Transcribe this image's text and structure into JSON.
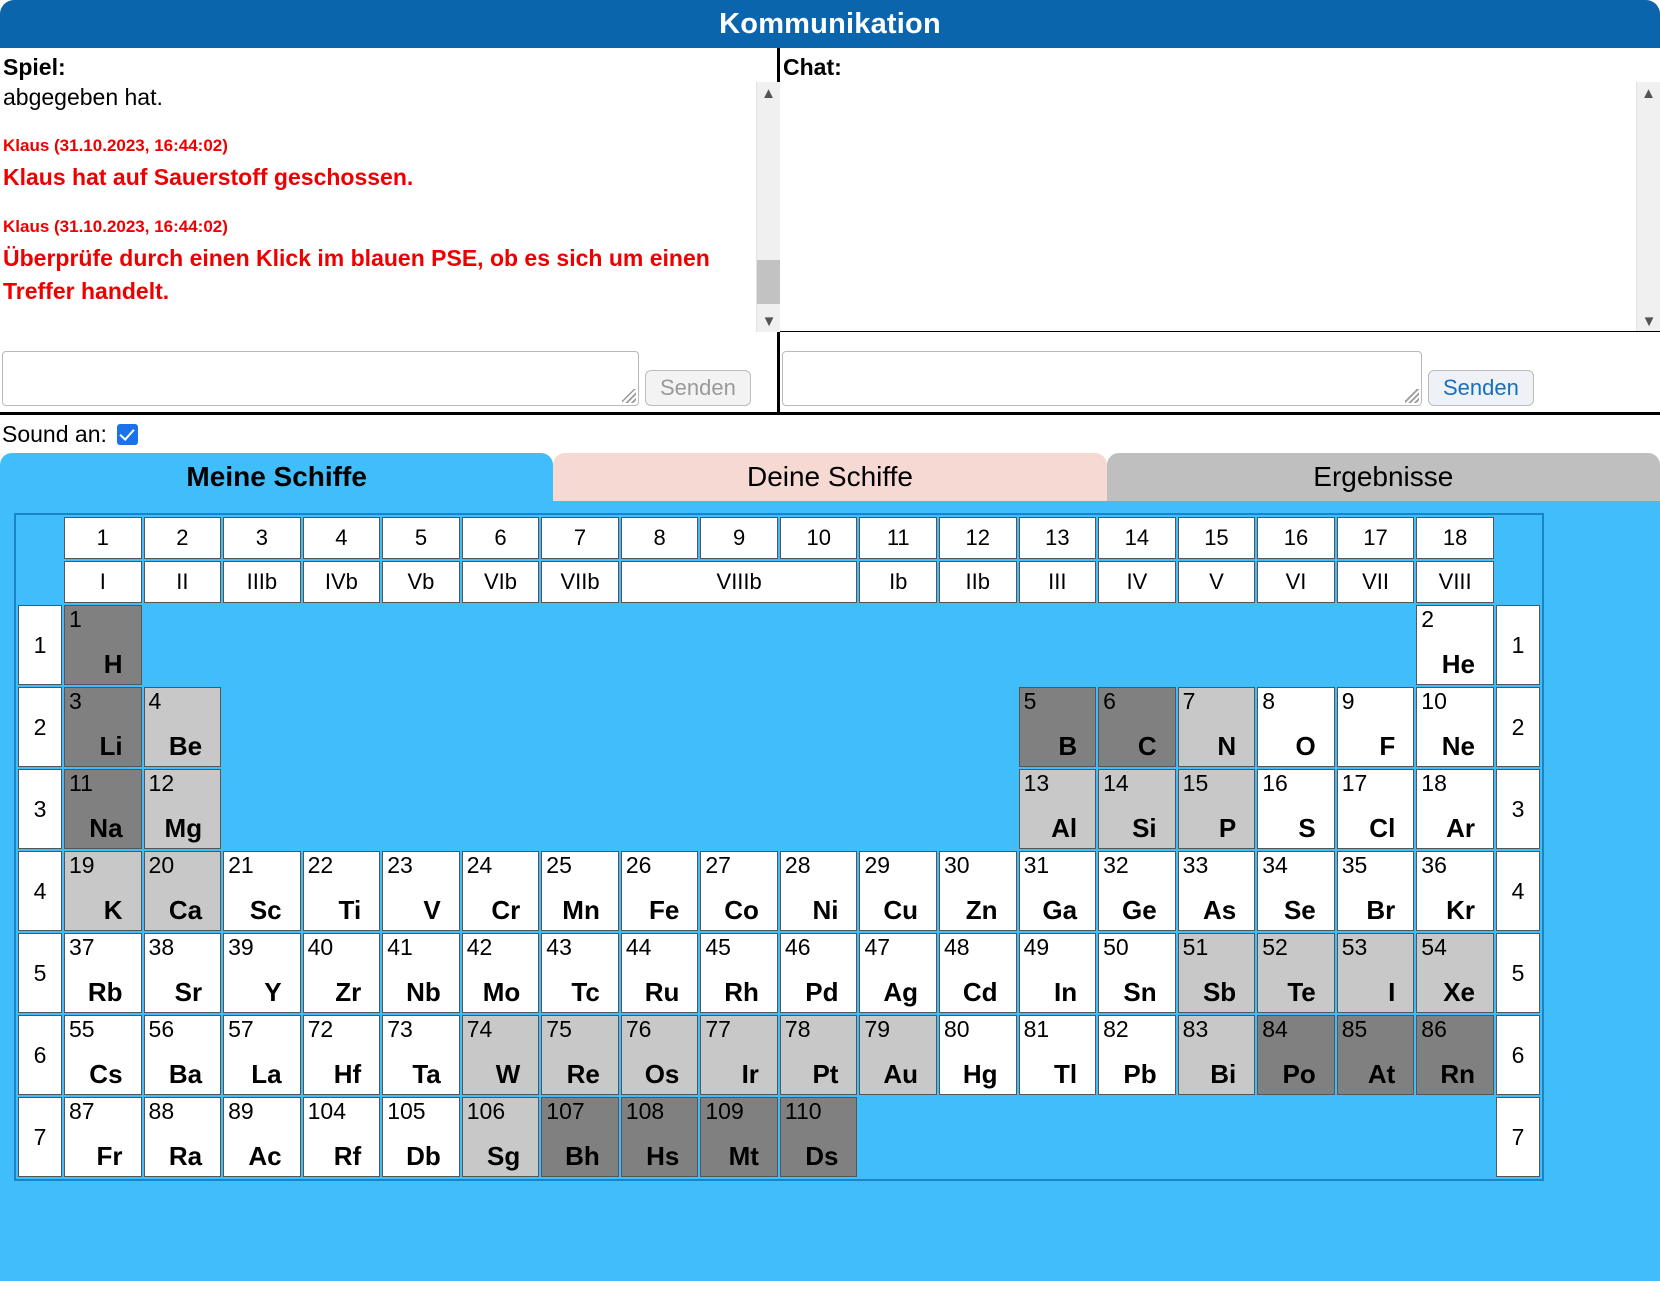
{
  "window": {
    "title": "Kommunikation"
  },
  "comm": {
    "game": {
      "label": "Spiel:",
      "entries": [
        {
          "type": "plain",
          "text": "abgegeben hat."
        },
        {
          "type": "meta",
          "text": "Klaus (31.10.2023, 16:44:02)"
        },
        {
          "type": "msg",
          "text": "Klaus hat auf Sauerstoff geschossen."
        },
        {
          "type": "meta",
          "text": "Klaus (31.10.2023, 16:44:02)"
        },
        {
          "type": "msg",
          "text": "Überprüfe durch einen Klick im blauen PSE, ob es sich um einen Treffer handelt."
        }
      ],
      "input_value": "",
      "send_label": "Senden"
    },
    "chat": {
      "label": "Chat:",
      "entries": [],
      "input_value": "",
      "send_label": "Senden"
    }
  },
  "sound": {
    "label": "Sound an:",
    "checked": true
  },
  "tabs": [
    {
      "id": "meine-schiffe",
      "label": "Meine Schiffe",
      "state": "active"
    },
    {
      "id": "deine-schiffe",
      "label": "Deine Schiffe",
      "state": "pink"
    },
    {
      "id": "ergebnisse",
      "label": "Ergebnisse",
      "state": "grey"
    }
  ],
  "pse": {
    "group_numbers": [
      "1",
      "2",
      "3",
      "4",
      "5",
      "6",
      "7",
      "8",
      "9",
      "10",
      "11",
      "12",
      "13",
      "14",
      "15",
      "16",
      "17",
      "18"
    ],
    "group_romans": [
      {
        "label": "I",
        "span": 1
      },
      {
        "label": "II",
        "span": 1
      },
      {
        "label": "IIIb",
        "span": 1
      },
      {
        "label": "IVb",
        "span": 1
      },
      {
        "label": "Vb",
        "span": 1
      },
      {
        "label": "VIb",
        "span": 1
      },
      {
        "label": "VIIb",
        "span": 1
      },
      {
        "label": "VIIIb",
        "span": 3
      },
      {
        "label": "Ib",
        "span": 1
      },
      {
        "label": "IIb",
        "span": 1
      },
      {
        "label": "III",
        "span": 1
      },
      {
        "label": "IV",
        "span": 1
      },
      {
        "label": "V",
        "span": 1
      },
      {
        "label": "VI",
        "span": 1
      },
      {
        "label": "VII",
        "span": 1
      },
      {
        "label": "VIII",
        "span": 1
      }
    ],
    "period_labels": [
      "1",
      "2",
      "3",
      "4",
      "5",
      "6",
      "7"
    ],
    "rows": [
      {
        "period": "1",
        "cells": [
          {
            "num": "1",
            "sym": "H",
            "shade": "dark"
          },
          {
            "blank": 16
          },
          {
            "num": "2",
            "sym": "He",
            "shade": "none"
          }
        ]
      },
      {
        "period": "2",
        "cells": [
          {
            "num": "3",
            "sym": "Li",
            "shade": "dark"
          },
          {
            "num": "4",
            "sym": "Be",
            "shade": "light"
          },
          {
            "blank": 10
          },
          {
            "num": "5",
            "sym": "B",
            "shade": "dark"
          },
          {
            "num": "6",
            "sym": "C",
            "shade": "dark"
          },
          {
            "num": "7",
            "sym": "N",
            "shade": "light"
          },
          {
            "num": "8",
            "sym": "O",
            "shade": "none"
          },
          {
            "num": "9",
            "sym": "F",
            "shade": "none"
          },
          {
            "num": "10",
            "sym": "Ne",
            "shade": "none"
          }
        ]
      },
      {
        "period": "3",
        "cells": [
          {
            "num": "11",
            "sym": "Na",
            "shade": "dark"
          },
          {
            "num": "12",
            "sym": "Mg",
            "shade": "light"
          },
          {
            "blank": 10
          },
          {
            "num": "13",
            "sym": "Al",
            "shade": "light"
          },
          {
            "num": "14",
            "sym": "Si",
            "shade": "light"
          },
          {
            "num": "15",
            "sym": "P",
            "shade": "light"
          },
          {
            "num": "16",
            "sym": "S",
            "shade": "none"
          },
          {
            "num": "17",
            "sym": "Cl",
            "shade": "none"
          },
          {
            "num": "18",
            "sym": "Ar",
            "shade": "none"
          }
        ]
      },
      {
        "period": "4",
        "cells": [
          {
            "num": "19",
            "sym": "K",
            "shade": "light"
          },
          {
            "num": "20",
            "sym": "Ca",
            "shade": "light"
          },
          {
            "num": "21",
            "sym": "Sc",
            "shade": "none"
          },
          {
            "num": "22",
            "sym": "Ti",
            "shade": "none"
          },
          {
            "num": "23",
            "sym": "V",
            "shade": "none"
          },
          {
            "num": "24",
            "sym": "Cr",
            "shade": "none"
          },
          {
            "num": "25",
            "sym": "Mn",
            "shade": "none"
          },
          {
            "num": "26",
            "sym": "Fe",
            "shade": "none"
          },
          {
            "num": "27",
            "sym": "Co",
            "shade": "none"
          },
          {
            "num": "28",
            "sym": "Ni",
            "shade": "none"
          },
          {
            "num": "29",
            "sym": "Cu",
            "shade": "none"
          },
          {
            "num": "30",
            "sym": "Zn",
            "shade": "none"
          },
          {
            "num": "31",
            "sym": "Ga",
            "shade": "none"
          },
          {
            "num": "32",
            "sym": "Ge",
            "shade": "none"
          },
          {
            "num": "33",
            "sym": "As",
            "shade": "none"
          },
          {
            "num": "34",
            "sym": "Se",
            "shade": "none"
          },
          {
            "num": "35",
            "sym": "Br",
            "shade": "none"
          },
          {
            "num": "36",
            "sym": "Kr",
            "shade": "none"
          }
        ]
      },
      {
        "period": "5",
        "cells": [
          {
            "num": "37",
            "sym": "Rb",
            "shade": "none"
          },
          {
            "num": "38",
            "sym": "Sr",
            "shade": "none"
          },
          {
            "num": "39",
            "sym": "Y",
            "shade": "none"
          },
          {
            "num": "40",
            "sym": "Zr",
            "shade": "none"
          },
          {
            "num": "41",
            "sym": "Nb",
            "shade": "none"
          },
          {
            "num": "42",
            "sym": "Mo",
            "shade": "none"
          },
          {
            "num": "43",
            "sym": "Tc",
            "shade": "none"
          },
          {
            "num": "44",
            "sym": "Ru",
            "shade": "none"
          },
          {
            "num": "45",
            "sym": "Rh",
            "shade": "none"
          },
          {
            "num": "46",
            "sym": "Pd",
            "shade": "none"
          },
          {
            "num": "47",
            "sym": "Ag",
            "shade": "none"
          },
          {
            "num": "48",
            "sym": "Cd",
            "shade": "none"
          },
          {
            "num": "49",
            "sym": "In",
            "shade": "none"
          },
          {
            "num": "50",
            "sym": "Sn",
            "shade": "none"
          },
          {
            "num": "51",
            "sym": "Sb",
            "shade": "light"
          },
          {
            "num": "52",
            "sym": "Te",
            "shade": "light"
          },
          {
            "num": "53",
            "sym": "I",
            "shade": "light"
          },
          {
            "num": "54",
            "sym": "Xe",
            "shade": "light"
          }
        ]
      },
      {
        "period": "6",
        "cells": [
          {
            "num": "55",
            "sym": "Cs",
            "shade": "none"
          },
          {
            "num": "56",
            "sym": "Ba",
            "shade": "none"
          },
          {
            "num": "57",
            "sym": "La",
            "shade": "none"
          },
          {
            "num": "72",
            "sym": "Hf",
            "shade": "none"
          },
          {
            "num": "73",
            "sym": "Ta",
            "shade": "none"
          },
          {
            "num": "74",
            "sym": "W",
            "shade": "light"
          },
          {
            "num": "75",
            "sym": "Re",
            "shade": "light"
          },
          {
            "num": "76",
            "sym": "Os",
            "shade": "light"
          },
          {
            "num": "77",
            "sym": "Ir",
            "shade": "light"
          },
          {
            "num": "78",
            "sym": "Pt",
            "shade": "light"
          },
          {
            "num": "79",
            "sym": "Au",
            "shade": "light"
          },
          {
            "num": "80",
            "sym": "Hg",
            "shade": "none"
          },
          {
            "num": "81",
            "sym": "Tl",
            "shade": "none"
          },
          {
            "num": "82",
            "sym": "Pb",
            "shade": "none"
          },
          {
            "num": "83",
            "sym": "Bi",
            "shade": "light"
          },
          {
            "num": "84",
            "sym": "Po",
            "shade": "dark"
          },
          {
            "num": "85",
            "sym": "At",
            "shade": "dark"
          },
          {
            "num": "86",
            "sym": "Rn",
            "shade": "dark"
          }
        ]
      },
      {
        "period": "7",
        "cells": [
          {
            "num": "87",
            "sym": "Fr",
            "shade": "none"
          },
          {
            "num": "88",
            "sym": "Ra",
            "shade": "none"
          },
          {
            "num": "89",
            "sym": "Ac",
            "shade": "none"
          },
          {
            "num": "104",
            "sym": "Rf",
            "shade": "none"
          },
          {
            "num": "105",
            "sym": "Db",
            "shade": "none"
          },
          {
            "num": "106",
            "sym": "Sg",
            "shade": "light"
          },
          {
            "num": "107",
            "sym": "Bh",
            "shade": "dark"
          },
          {
            "num": "108",
            "sym": "Hs",
            "shade": "dark"
          },
          {
            "num": "109",
            "sym": "Mt",
            "shade": "dark"
          },
          {
            "num": "110",
            "sym": "Ds",
            "shade": "dark"
          },
          {
            "blank": 8
          }
        ]
      }
    ]
  },
  "colors": {
    "title_bar": "#0b65ad",
    "pse_background": "#40bdfb",
    "tab_active": "#40bdfb",
    "tab_pink": "#f5d9d2",
    "tab_grey": "#bfbfbf",
    "log_alert": "#ee0000",
    "shade_light": "#c8c8c8",
    "shade_dark": "#808080"
  }
}
